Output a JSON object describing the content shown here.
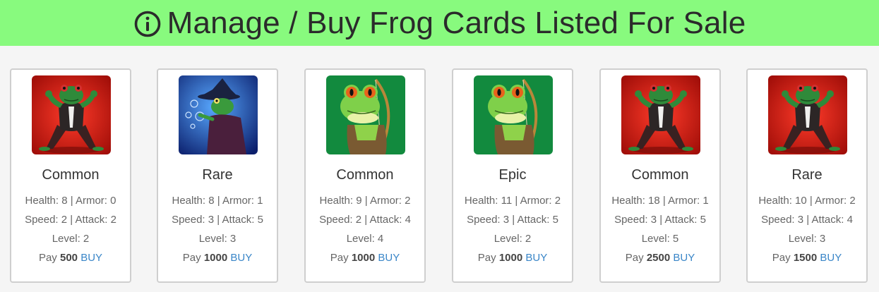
{
  "header": {
    "title": "Manage / Buy Frog Cards Listed For Sale",
    "background": "#88fa7e",
    "icon": "info-circle-icon"
  },
  "labels": {
    "health": "Health:",
    "armor": "Armor:",
    "speed": "Speed:",
    "attack": "Attack:",
    "level": "Level:",
    "pay": "Pay",
    "buy": "BUY",
    "separator": "|"
  },
  "cards": [
    {
      "rarity": "Common",
      "health": "8",
      "armor": "0",
      "speed": "2",
      "attack": "2",
      "level": "2",
      "price": "500",
      "art": "ninja-frog-red"
    },
    {
      "rarity": "Rare",
      "health": "8",
      "armor": "1",
      "speed": "3",
      "attack": "5",
      "level": "3",
      "price": "1000",
      "art": "wizard-frog-blue"
    },
    {
      "rarity": "Common",
      "health": "9",
      "armor": "2",
      "speed": "2",
      "attack": "4",
      "level": "4",
      "price": "1000",
      "art": "archer-frog-green"
    },
    {
      "rarity": "Epic",
      "health": "11",
      "armor": "2",
      "speed": "3",
      "attack": "5",
      "level": "2",
      "price": "1000",
      "art": "archer-frog-green"
    },
    {
      "rarity": "Common",
      "health": "18",
      "armor": "1",
      "speed": "3",
      "attack": "5",
      "level": "5",
      "price": "2500",
      "art": "ninja-frog-red"
    },
    {
      "rarity": "Rare",
      "health": "10",
      "armor": "2",
      "speed": "3",
      "attack": "4",
      "level": "3",
      "price": "1500",
      "art": "ninja-frog-red"
    }
  ],
  "colors": {
    "link": "#3a86c8",
    "border": "#cfcfcf"
  }
}
